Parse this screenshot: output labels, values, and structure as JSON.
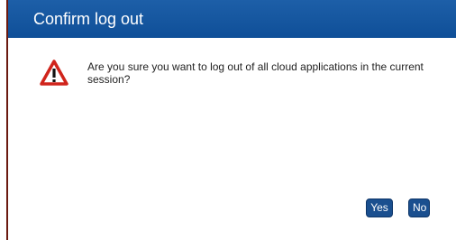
{
  "dialog": {
    "title": "Confirm log out",
    "icon": "warning-triangle-icon",
    "message": "Are you sure you want to log out of all cloud applications in the current session?",
    "buttons": {
      "yes_label": "Yes",
      "no_label": "No"
    }
  },
  "colors": {
    "titlebar": "#1358a2",
    "button": "#1a4f8f",
    "warning_red": "#d0241b"
  }
}
